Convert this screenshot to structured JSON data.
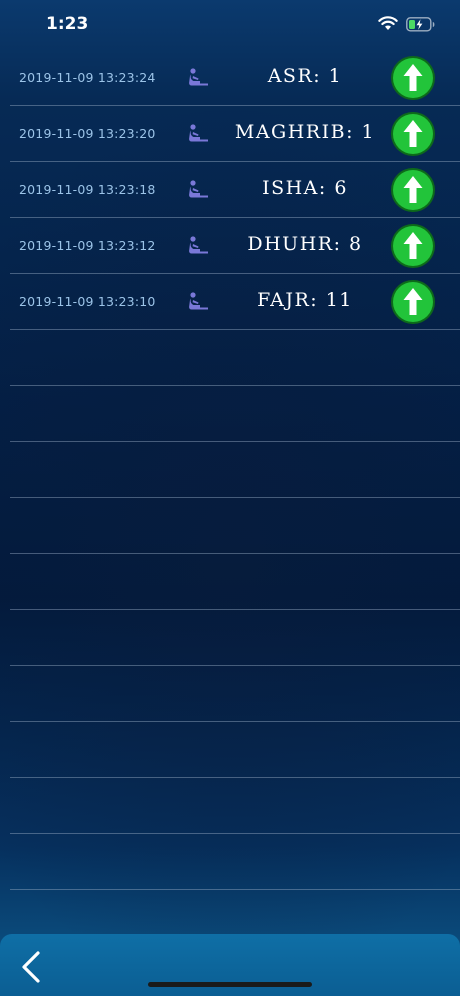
{
  "status_bar": {
    "time": "1:23",
    "icons": [
      "wifi-icon",
      "battery-charging-icon"
    ]
  },
  "entries": [
    {
      "timestamp": "2019-11-09 13:23:24",
      "prayer": "ASR: 1",
      "icon": "praying-person-icon",
      "action_icon": "up-arrow-icon"
    },
    {
      "timestamp": "2019-11-09 13:23:20",
      "prayer": "MAGHRIB: 1",
      "icon": "praying-person-icon",
      "action_icon": "up-arrow-icon"
    },
    {
      "timestamp": "2019-11-09 13:23:18",
      "prayer": "ISHA: 6",
      "icon": "praying-person-icon",
      "action_icon": "up-arrow-icon"
    },
    {
      "timestamp": "2019-11-09 13:23:12",
      "prayer": "DHUHR: 8",
      "icon": "praying-person-icon",
      "action_icon": "up-arrow-icon"
    },
    {
      "timestamp": "2019-11-09 13:23:10",
      "prayer": "FAJR: 11",
      "icon": "praying-person-icon",
      "action_icon": "up-arrow-icon"
    }
  ],
  "empty_rows": 10,
  "navigation": {
    "back_icon": "chevron-left-icon"
  },
  "colors": {
    "background_top": "#0b3a6e",
    "background_mid": "#031a3c",
    "background_bottom": "#0d5a8c",
    "timestamp_text": "#9cc4e8",
    "prayer_text": "#ffffff",
    "icon_purple": "#7a78d8",
    "button_green": "#22c43a",
    "bottom_bar": "#0f6fa6"
  }
}
